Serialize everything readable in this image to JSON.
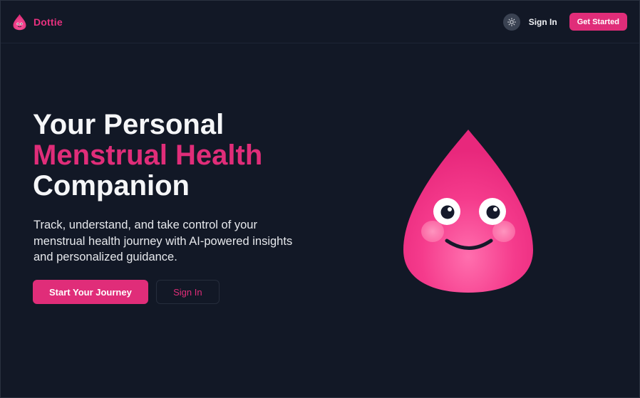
{
  "brand": {
    "name": "Dottie",
    "logo_icon": "droplet-logo-icon",
    "color": "#e8317f"
  },
  "nav": {
    "theme_toggle_icon": "sun-icon",
    "sign_in_label": "Sign In",
    "get_started_label": "Get Started"
  },
  "hero": {
    "title_line1": "Your Personal",
    "title_line2": "Menstrual Health",
    "title_line3": "Companion",
    "subtitle": "Track, understand, and take control of your menstrual health journey with AI-powered insights and personalized guidance.",
    "primary_button": "Start Your Journey",
    "secondary_button": "Sign In",
    "mascot_icon": "smiling-droplet-mascot-icon"
  },
  "colors": {
    "background": "#121826",
    "accent": "#e02d79",
    "text": "#f5f6f8"
  }
}
